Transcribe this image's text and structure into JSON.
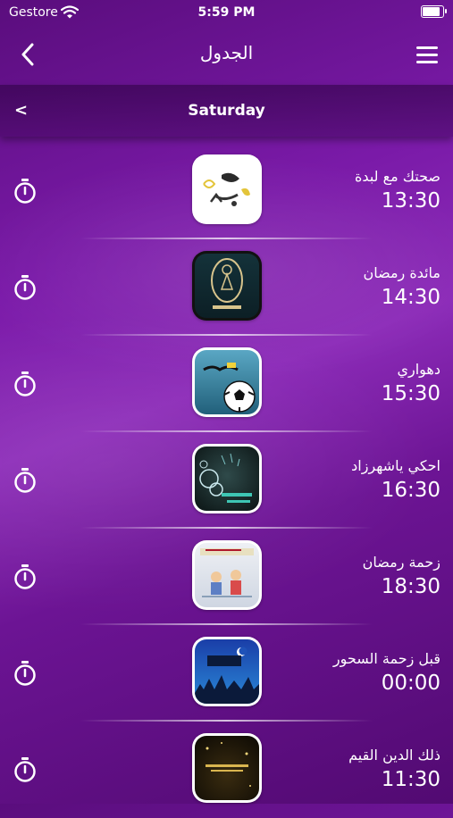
{
  "status": {
    "carrier": "Gestore",
    "time": "5:59 PM"
  },
  "nav": {
    "title": "الجدول"
  },
  "day": {
    "label": "Saturday",
    "prev_glyph": "<"
  },
  "schedule": [
    {
      "title": "صحتك مع لبدة",
      "time": "13:30",
      "thumb": "sehtak"
    },
    {
      "title": "مائدة رمضان",
      "time": "14:30",
      "thumb": "maeda"
    },
    {
      "title": "دهواري",
      "time": "15:30",
      "thumb": "dahwari"
    },
    {
      "title": "احكي ياشهرزاد",
      "time": "16:30",
      "thumb": "ehki"
    },
    {
      "title": "زحمة رمضان",
      "time": "18:30",
      "thumb": "zahma"
    },
    {
      "title": "قبل زحمة السحور",
      "time": "00:00",
      "thumb": "sohour"
    },
    {
      "title": "ذلك الدين القيم",
      "time": "11:30",
      "thumb": "deen"
    }
  ],
  "icons": {
    "back": "chevron-left-icon",
    "menu": "hamburger-menu-icon",
    "reminder": "stopwatch-icon"
  },
  "colors": {
    "background": "#7a1aa8",
    "accent": "#ffffff"
  }
}
